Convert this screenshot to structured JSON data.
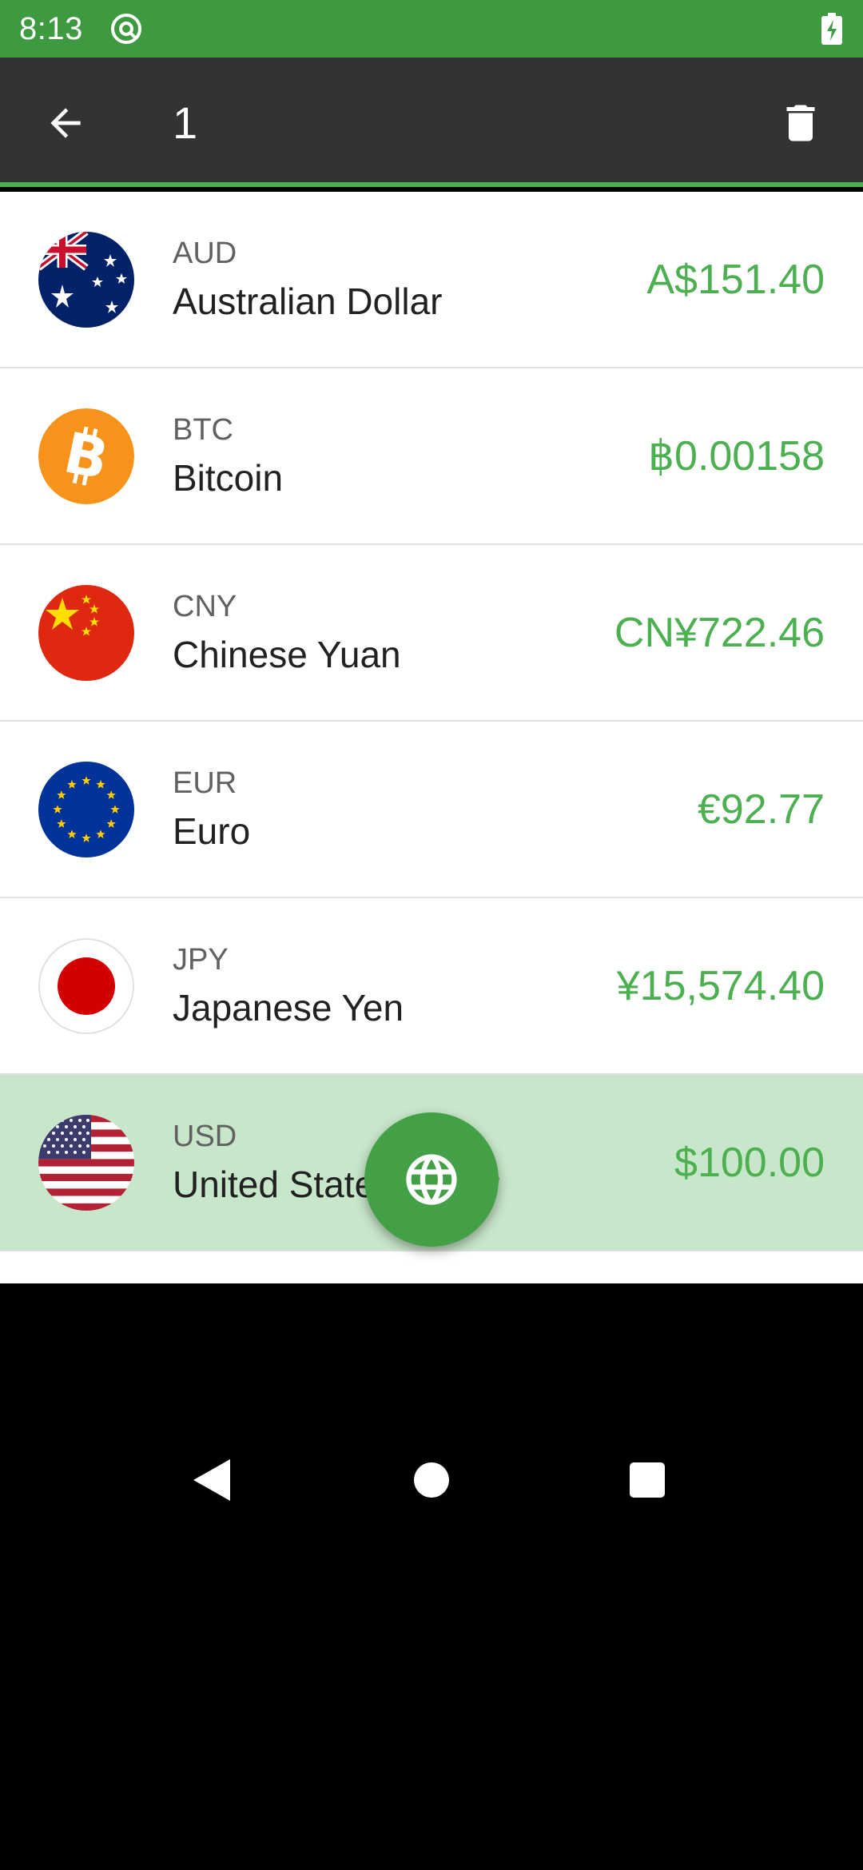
{
  "status_bar": {
    "time": "8:13"
  },
  "app_bar": {
    "title": "1"
  },
  "currencies": [
    {
      "code": "AUD",
      "name": "Australian Dollar",
      "amount": "A$151.40"
    },
    {
      "code": "BTC",
      "name": "Bitcoin",
      "amount": "฿0.00158"
    },
    {
      "code": "CNY",
      "name": "Chinese Yuan",
      "amount": "CN¥722.46"
    },
    {
      "code": "EUR",
      "name": "Euro",
      "amount": "€92.77"
    },
    {
      "code": "JPY",
      "name": "Japanese Yen",
      "amount": "¥15,574.40"
    },
    {
      "code": "USD",
      "name": "United States Dollar",
      "amount": "$100.00",
      "selected": true
    }
  ],
  "colors": {
    "status_bar": "#3e9a41",
    "app_bar": "#333333",
    "accent": "#4caf50",
    "selected_row": "#c8e6c9"
  },
  "icons": {
    "back": "arrow-left-icon",
    "delete": "trash-icon",
    "fab": "globe-icon"
  }
}
